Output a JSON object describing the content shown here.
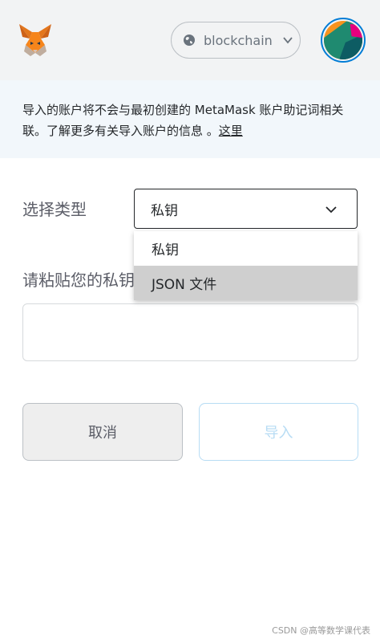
{
  "header": {
    "network_label": "blockchain",
    "accent_color": "#037dd6"
  },
  "notice": {
    "text": "导入的账户将不会与最初创建的 MetaMask 账户助记词相关联。了解更多有关导入账户的信息 。",
    "link_text": "这里"
  },
  "form": {
    "type_label": "选择类型",
    "selected_type": "私钥",
    "paste_label": "请粘贴您的私钥",
    "key_input_value": ""
  },
  "dropdown": {
    "options": [
      "私钥",
      "JSON 文件"
    ],
    "highlighted_index": 1
  },
  "buttons": {
    "cancel": "取消",
    "import": "导入"
  },
  "watermark": "CSDN @高等数学课代表",
  "icons": [
    "metamask-fox-icon",
    "globe-icon",
    "chevron-down-icon",
    "account-identicon"
  ]
}
